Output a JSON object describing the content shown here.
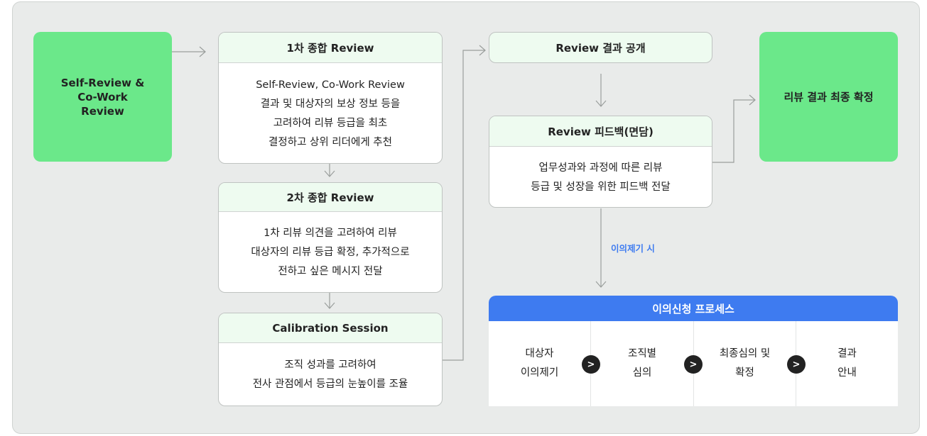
{
  "self_review": "Self-Review &\nCo-Work\nReview",
  "review1": {
    "title": "1차 종합 Review",
    "body": "Self-Review, Co-Work Review\n결과 및 대상자의 보상 정보 등을\n고려하여 리뷰 등급을 최초\n결정하고 상위 리더에게 추천"
  },
  "review2": {
    "title": "2차 종합 Review",
    "body": "1차 리뷰 의견을 고려하여 리뷰\n대상자의 리뷰 등급 확정, 추가적으로\n전하고 싶은 메시지 전달"
  },
  "calibration": {
    "title": "Calibration Session",
    "body": "조직 성과를 고려하여\n전사 관점에서 등급의 눈높이를 조율"
  },
  "publish": "Review 결과 공개",
  "feedback": {
    "title": "Review 피드백(면담)",
    "body": "업무성과와 과정에 따른 리뷰\n등급 및 성장을 위한  피드백 전달"
  },
  "final": "리뷰 결과 최종 확정",
  "objection_note": "이의제기 시",
  "appeal": {
    "title": "이의신청 프로세스",
    "steps": [
      "대상자\n이의제기",
      "조직별\n심의",
      "최종심의 및\n확정",
      "결과\n안내"
    ],
    "arrow": ">"
  },
  "colors": {
    "green": "#6be88a",
    "light_green": "#eefbf0",
    "blue": "#3e7bf0",
    "background": "#e9ebea"
  }
}
